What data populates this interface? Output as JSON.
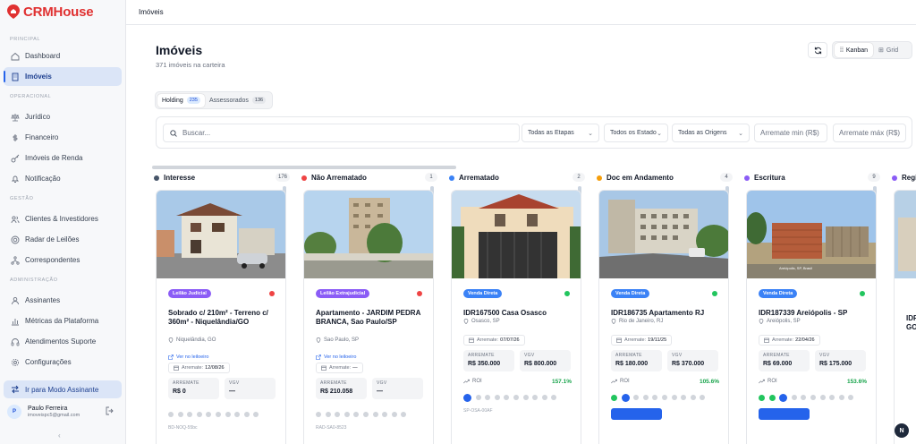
{
  "app": {
    "name": "CRMHouse"
  },
  "sidebar": {
    "sections": [
      {
        "label": "PRINCIPAL",
        "items": [
          {
            "label": "Dashboard",
            "icon": "home-icon"
          },
          {
            "label": "Imóveis",
            "icon": "building-icon",
            "active": true
          }
        ]
      },
      {
        "label": "OPERACIONAL",
        "items": [
          {
            "label": "Jurídico",
            "icon": "scale-icon"
          },
          {
            "label": "Financeiro",
            "icon": "dollar-icon"
          },
          {
            "label": "Imóveis de Renda",
            "icon": "key-icon"
          },
          {
            "label": "Notificação",
            "icon": "bell-icon"
          }
        ]
      },
      {
        "label": "GESTÃO",
        "items": [
          {
            "label": "Clientes & Investidores",
            "icon": "users-icon"
          },
          {
            "label": "Radar de Leilões",
            "icon": "radar-icon"
          },
          {
            "label": "Correspondentes",
            "icon": "network-icon"
          }
        ]
      },
      {
        "label": "ADMINISTRAÇÃO",
        "items": [
          {
            "label": "Assinantes",
            "icon": "user-group-icon"
          },
          {
            "label": "Métricas da Plataforma",
            "icon": "bar-chart-icon"
          },
          {
            "label": "Atendimentos Suporte",
            "icon": "headset-icon"
          },
          {
            "label": "Configurações",
            "icon": "gear-icon"
          }
        ]
      }
    ],
    "assign_mode": "Ir para Modo Assinante",
    "user": {
      "initial": "P",
      "name": "Paulo Ferreira",
      "email": "imoveispc5@gmail.com"
    }
  },
  "topbar": {
    "breadcrumb": "Imóveis"
  },
  "header": {
    "title": "Imóveis",
    "subtitle": "371 imóveis na carteira"
  },
  "view_toggle": [
    {
      "label": "Kanban",
      "active": true
    },
    {
      "label": "Grid",
      "active": false
    }
  ],
  "segments": [
    {
      "label": "Holding",
      "count": "235",
      "active": true
    },
    {
      "label": "Assessorados",
      "count": "136",
      "active": false
    }
  ],
  "filters": {
    "search_placeholder": "Buscar...",
    "etapas": "Todas as Etapas",
    "estados": "Todos os Estados",
    "origens": "Todas as Origens",
    "arremate_min": "Arremate min (R$)",
    "arremate_max": "Arremate máx (R$)"
  },
  "columns": [
    {
      "name": "Interesse",
      "count": "176",
      "color": "#475569"
    },
    {
      "name": "Não Arrematado",
      "count": "1",
      "color": "#ef4444"
    },
    {
      "name": "Arrematado",
      "count": "2",
      "color": "#3b82f6"
    },
    {
      "name": "Doc em Andamento",
      "count": "4",
      "color": "#f59e0b"
    },
    {
      "name": "Escritura",
      "count": "9",
      "color": "#8b5cf6"
    },
    {
      "name": "Regi",
      "count": "",
      "color": "#8b5cf6"
    }
  ],
  "cards": [
    {
      "badge": "Leilão Judicial",
      "badge_color": "#8b5cf6",
      "status_color": "#ef4444",
      "title": "Sobrado c/ 210m² - Terreno c/ 360m² - Niquelândia/GO",
      "location": "Niquelândia, GO",
      "link": "Ver no leiloeiro",
      "date_label": "Arremate:",
      "date": "12/08/26",
      "arremate_label": "ARREMATE",
      "arremate": "R$ 0",
      "vgv_label": "VGV",
      "vgv": "—",
      "roi_label": "",
      "roi": "",
      "code": "BD-NOQ-55bc",
      "progress": {
        "done": 0,
        "current": -1
      }
    },
    {
      "badge": "Leilão Extrajudicial",
      "badge_color": "#8b5cf6",
      "status_color": "#ef4444",
      "title": "Apartamento - JARDIM PEDRA BRANCA, Sao Paulo/SP",
      "location": "Sao Paulo, SP",
      "link": "Ver no leiloeiro",
      "date_label": "Arremate:",
      "date": "—",
      "arremate_label": "ARREMATE",
      "arremate": "R$ 210.058",
      "vgv_label": "VGV",
      "vgv": "—",
      "roi_label": "",
      "roi": "",
      "code": "RAD-SA0-8523",
      "progress": {
        "done": 0,
        "current": -1
      }
    },
    {
      "badge": "Venda Direta",
      "badge_color": "#3b82f6",
      "status_color": "#22c55e",
      "title": "IDR167500 Casa Osasco",
      "location": "Osasco, SP",
      "link": "",
      "date_label": "Arremate:",
      "date": "07/07/26",
      "arremate_label": "ARREMATE",
      "arremate": "R$ 350.000",
      "vgv_label": "VGV",
      "vgv": "R$ 800.000",
      "roi_label": "ROI",
      "roi": "157.1%",
      "code": "SP-OSA-00AF",
      "progress": {
        "done": 0,
        "current": 0
      }
    },
    {
      "badge": "Venda Direta",
      "badge_color": "#3b82f6",
      "status_color": "#22c55e",
      "title": "IDR186735 Apartamento RJ",
      "location": "Rio de Janeiro, RJ",
      "link": "",
      "date_label": "Arremate:",
      "date": "19/11/25",
      "arremate_label": "ARREMATE",
      "arremate": "R$ 180.000",
      "vgv_label": "VGV",
      "vgv": "R$ 370.000",
      "roi_label": "ROI",
      "roi": "105.6%",
      "code": "",
      "progress": {
        "done": 1,
        "current": 1
      }
    },
    {
      "badge": "Venda Direta",
      "badge_color": "#3b82f6",
      "status_color": "#22c55e",
      "title": "IDR187339 Areiópolis - SP",
      "location": "Areiópolis, SP",
      "link": "",
      "date_label": "Arremate:",
      "date": "22/04/26",
      "arremate_label": "ARREMATE",
      "arremate": "R$ 69.000",
      "vgv_label": "VGV",
      "vgv": "R$ 175.000",
      "roi_label": "ROI",
      "roi": "153.6%",
      "code": "",
      "progress": {
        "done": 2,
        "current": 2
      }
    }
  ],
  "partial_card": {
    "title": "IDR",
    "title2": "GO"
  }
}
